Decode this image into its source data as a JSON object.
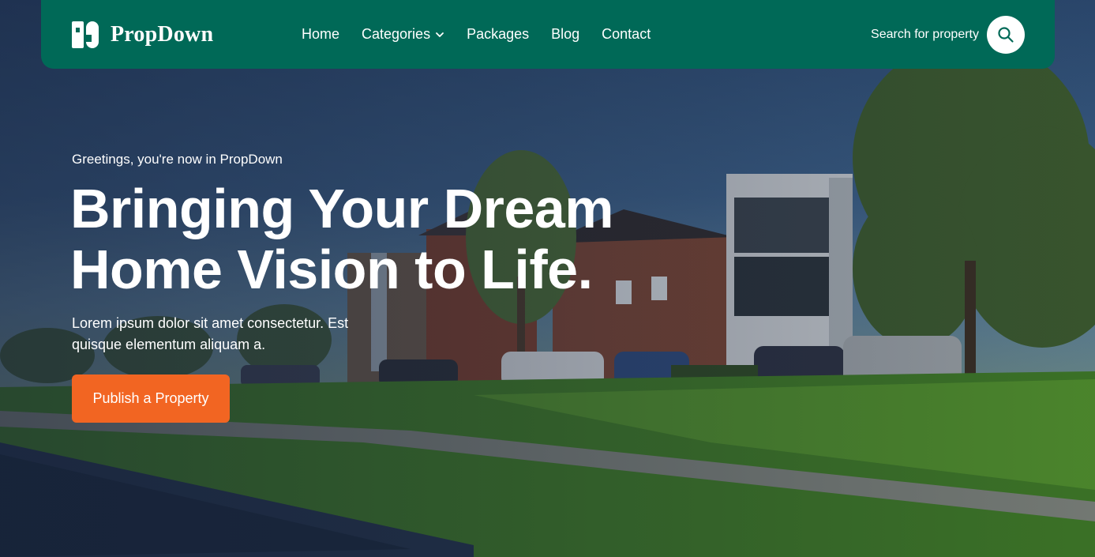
{
  "brand": {
    "name": "PropDown",
    "logo_icon": "propdown-logo-icon"
  },
  "nav": {
    "items": [
      {
        "label": "Home"
      },
      {
        "label": "Categories",
        "has_dropdown": true
      },
      {
        "label": "Packages"
      },
      {
        "label": "Blog"
      },
      {
        "label": "Contact"
      }
    ]
  },
  "search": {
    "label": "Search for property",
    "icon": "search-icon"
  },
  "hero": {
    "greeting": "Greetings, you're now in PropDown",
    "headline_line1": "Bringing Your Dream",
    "headline_line2": "Home Vision to Life.",
    "subtext_line1": "Lorem ipsum dolor sit amet consectetur. Est",
    "subtext_line2": "quisque elementum aliquam a.",
    "cta_label": "Publish a Property"
  },
  "colors": {
    "navbar_bg": "#006957",
    "cta_bg": "#f26522",
    "text": "#ffffff"
  }
}
